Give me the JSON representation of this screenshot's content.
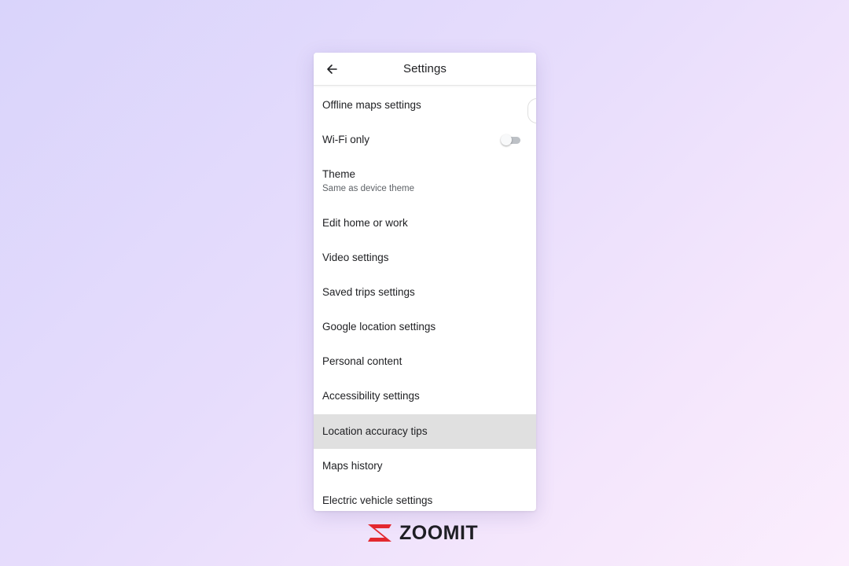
{
  "header": {
    "title": "Settings",
    "back_icon": "arrow-back-icon"
  },
  "settings": {
    "offline_maps": "Offline maps settings",
    "wifi_only": {
      "label": "Wi-Fi only",
      "enabled": false
    },
    "theme": {
      "label": "Theme",
      "value": "Same as device theme"
    },
    "edit_home_work": "Edit home or work",
    "video": "Video settings",
    "saved_trips": "Saved trips settings",
    "google_location": "Google location settings",
    "personal_content": "Personal content",
    "accessibility": "Accessibility settings",
    "location_accuracy": "Location accuracy tips",
    "maps_history": "Maps history",
    "electric_vehicle": "Electric vehicle settings"
  },
  "highlighted_item": "Location accuracy tips",
  "branding": {
    "logo_text": "ZOOMIT",
    "logo_icon": "zoomit-z-logo",
    "accent_color": "#e3282f"
  },
  "colors": {
    "highlight_row": "#e0e0e0",
    "text_primary": "#202124",
    "text_secondary": "#5f6368",
    "toggle_off_track": "#bdc1c6"
  }
}
